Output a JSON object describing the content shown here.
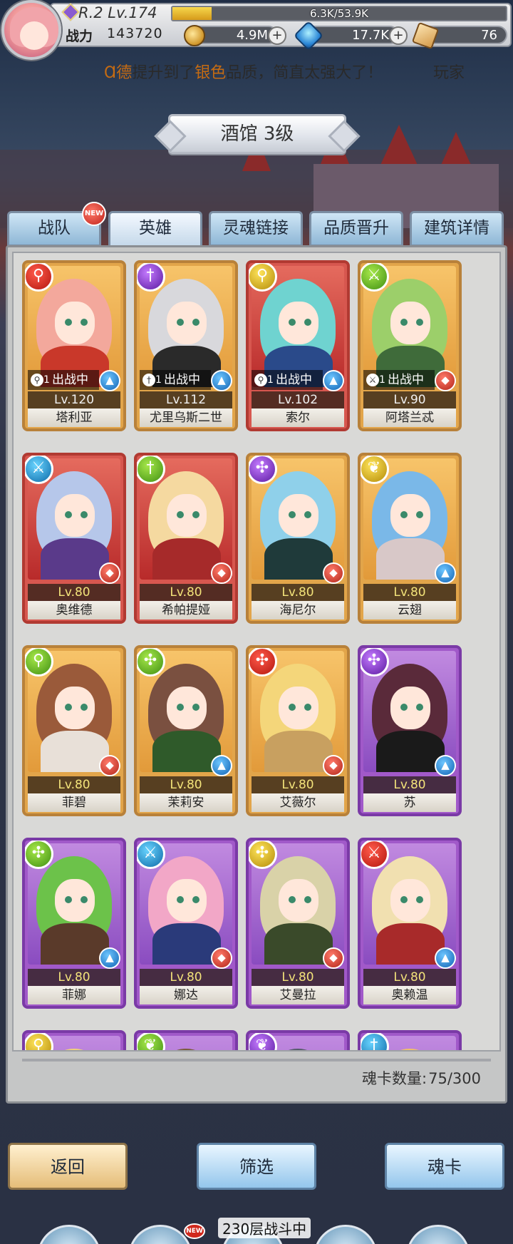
{
  "player": {
    "rank": "R.2 Lv.174",
    "exp": "6.3K/53.9K",
    "exp_fraction": 0.117,
    "power_label": "战力",
    "power_value": "143720"
  },
  "resources": {
    "gold": "4.9M",
    "gems": "17.7K",
    "cards": "76",
    "plus": "+"
  },
  "marquee": {
    "prefix": "Ɑ德",
    "verb": "提升到了",
    "quality": "银色",
    "suffix": "品质，简直太强大了！",
    "tail": "玩家"
  },
  "title": "酒馆 3级",
  "tabs": [
    {
      "label": "战队",
      "badge": "NEW"
    },
    {
      "label": "英雄"
    },
    {
      "label": "灵魂链接"
    },
    {
      "label": "品质晋升"
    },
    {
      "label": "建筑详情"
    }
  ],
  "heroes": [
    {
      "name": "塔利亚",
      "level": "Lv.120",
      "frame": "gold",
      "class": "cls-red",
      "class_glyph": "⚲",
      "deployed": "出战中",
      "deploy_num": "1",
      "attr": "attr-blue",
      "attr_glyph": "▲"
    },
    {
      "name": "尤里乌斯二世",
      "level": "Lv.112",
      "frame": "gold",
      "class": "cls-purple",
      "class_glyph": "†",
      "deployed": "出战中",
      "deploy_num": "1",
      "attr": "attr-blue",
      "attr_glyph": "▲"
    },
    {
      "name": "索尔",
      "level": "Lv.102",
      "frame": "red",
      "class": "cls-yellow",
      "class_glyph": "⚲",
      "deployed": "出战中",
      "deploy_num": "1",
      "attr": "attr-blue",
      "attr_glyph": "▲"
    },
    {
      "name": "阿塔兰忒",
      "level": "Lv.90",
      "frame": "gold",
      "class": "cls-green",
      "class_glyph": "⚔",
      "deployed": "出战中",
      "deploy_num": "1",
      "attr": "attr-red",
      "attr_glyph": "◆"
    },
    {
      "name": "奥维德",
      "level": "Lv.80",
      "frame": "red",
      "class": "cls-blue",
      "class_glyph": "⚔",
      "attr": "attr-red",
      "attr_glyph": "◆"
    },
    {
      "name": "希帕提娅",
      "level": "Lv.80",
      "frame": "red",
      "class": "cls-green",
      "class_glyph": "†",
      "attr": "attr-red",
      "attr_glyph": "◆"
    },
    {
      "name": "海尼尔",
      "level": "Lv.80",
      "frame": "gold",
      "class": "cls-purple",
      "class_glyph": "✣",
      "attr": "attr-red",
      "attr_glyph": "◆"
    },
    {
      "name": "云翅",
      "level": "Lv.80",
      "frame": "gold",
      "class": "cls-yellow",
      "class_glyph": "❦",
      "attr": "attr-blue",
      "attr_glyph": "▲"
    },
    {
      "name": "菲碧",
      "level": "Lv.80",
      "frame": "gold",
      "class": "cls-green",
      "class_glyph": "⚲",
      "attr": "attr-red",
      "attr_glyph": "◆"
    },
    {
      "name": "茉莉安",
      "level": "Lv.80",
      "frame": "gold",
      "class": "cls-green",
      "class_glyph": "✣",
      "attr": "attr-blue",
      "attr_glyph": "▲"
    },
    {
      "name": "艾薇尔",
      "level": "Lv.80",
      "frame": "gold",
      "class": "cls-red",
      "class_glyph": "✣",
      "attr": "attr-red",
      "attr_glyph": "◆"
    },
    {
      "name": "苏",
      "level": "Lv.80",
      "frame": "purple",
      "class": "cls-purple",
      "class_glyph": "✣",
      "attr": "attr-blue",
      "attr_glyph": "▲"
    },
    {
      "name": "菲娜",
      "level": "Lv.80",
      "frame": "purple",
      "class": "cls-green",
      "class_glyph": "✣",
      "attr": "attr-blue",
      "attr_glyph": "▲"
    },
    {
      "name": "娜达",
      "level": "Lv.80",
      "frame": "purple",
      "class": "cls-blue",
      "class_glyph": "⚔",
      "attr": "attr-red",
      "attr_glyph": "◆"
    },
    {
      "name": "艾曼拉",
      "level": "Lv.80",
      "frame": "purple",
      "class": "cls-yellow",
      "class_glyph": "✣",
      "attr": "attr-red",
      "attr_glyph": "◆"
    },
    {
      "name": "奥赖温",
      "level": "Lv.80",
      "frame": "purple",
      "class": "cls-red",
      "class_glyph": "⚔",
      "attr": "attr-blue",
      "attr_glyph": "▲"
    },
    {
      "name": "",
      "level": "",
      "frame": "purple",
      "class": "cls-yellow",
      "class_glyph": "⚲"
    },
    {
      "name": "",
      "level": "",
      "frame": "purple",
      "class": "cls-green",
      "class_glyph": "❦"
    },
    {
      "name": "",
      "level": "",
      "frame": "purple",
      "class": "cls-purple",
      "class_glyph": "❦"
    },
    {
      "name": "",
      "level": "",
      "frame": "purple",
      "class": "cls-blue",
      "class_glyph": "†"
    }
  ],
  "soul_count": {
    "label": "魂卡数量:",
    "value": "75/300"
  },
  "buttons": {
    "back": "返回",
    "filter": "筛选",
    "soul_card": "魂卡"
  },
  "battle_status": "230层战斗中",
  "nav_badge": "NEW"
}
